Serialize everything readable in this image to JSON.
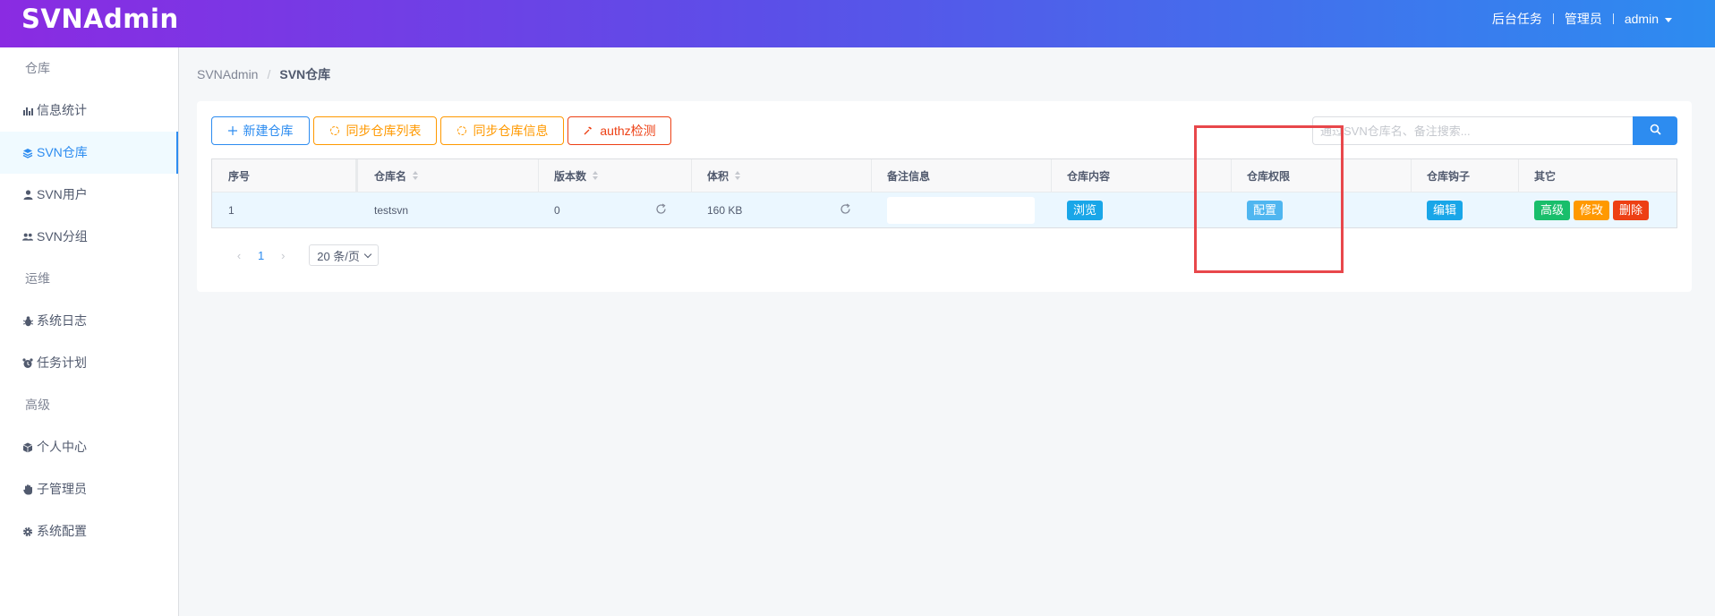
{
  "header": {
    "logo": "SVNAdmin",
    "nav": [
      "后台任务",
      "管理员",
      "admin"
    ]
  },
  "sidebar": {
    "groups": [
      {
        "title": "仓库",
        "items": [
          {
            "label": "信息统计",
            "icon": "bar-chart-icon"
          },
          {
            "label": "SVN仓库",
            "icon": "layers-icon",
            "active": true
          },
          {
            "label": "SVN用户",
            "icon": "user-icon"
          },
          {
            "label": "SVN分组",
            "icon": "group-icon"
          }
        ]
      },
      {
        "title": "运维",
        "items": [
          {
            "label": "系统日志",
            "icon": "bug-icon"
          },
          {
            "label": "任务计划",
            "icon": "alarm-icon"
          }
        ]
      },
      {
        "title": "高级",
        "items": [
          {
            "label": "个人中心",
            "icon": "cube-icon"
          },
          {
            "label": "子管理员",
            "icon": "hand-icon"
          },
          {
            "label": "系统配置",
            "icon": "gear-icon"
          }
        ]
      }
    ]
  },
  "breadcrumb": {
    "root": "SVNAdmin",
    "current": "SVN仓库"
  },
  "toolbar": {
    "new_repo": "新建仓库",
    "sync_list": "同步仓库列表",
    "sync_info": "同步仓库信息",
    "authz_check": "authz检测"
  },
  "search": {
    "placeholder": "通过SVN仓库名、备注搜索..."
  },
  "table": {
    "columns": [
      "序号",
      "仓库名",
      "版本数",
      "体积",
      "备注信息",
      "仓库内容",
      "仓库权限",
      "仓库钩子",
      "其它"
    ],
    "rows": [
      {
        "index": "1",
        "name": "testsvn",
        "revisions": "0",
        "size": "160 KB",
        "note": "",
        "content_btn": "浏览",
        "perm_btn": "配置",
        "hook_btn": "编辑",
        "advanced_btn": "高级",
        "edit_btn": "修改",
        "delete_btn": "删除"
      }
    ]
  },
  "pagination": {
    "current_page": "1",
    "page_size": "20 条/页"
  },
  "colors": {
    "primary": "#2d8cf0",
    "warning": "#ff9900",
    "error": "#ed4014",
    "success": "#19be6b",
    "highlight": "#e8474b"
  }
}
